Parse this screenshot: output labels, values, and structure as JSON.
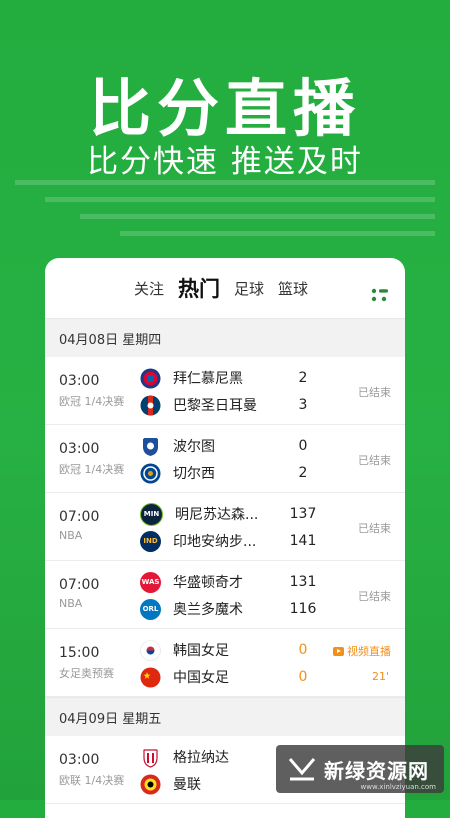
{
  "hero": {
    "title": "比分直播",
    "subtitle": "比分快速 推送及时"
  },
  "tabs": [
    {
      "label": "关注",
      "active": false
    },
    {
      "label": "热门",
      "active": true
    },
    {
      "label": "足球",
      "active": false
    },
    {
      "label": "篮球",
      "active": false
    }
  ],
  "menu_icon": "grid-menu-icon",
  "sections": [
    {
      "date": "04月08日 星期四",
      "matches": [
        {
          "time": "03:00",
          "competition": "欧冠 1/4决赛",
          "home": {
            "name": "拜仁慕尼黑",
            "logo": "bayern-logo",
            "score": "2"
          },
          "away": {
            "name": "巴黎圣日耳曼",
            "logo": "psg-logo",
            "score": "3"
          },
          "status": "已结束"
        },
        {
          "time": "03:00",
          "competition": "欧冠 1/4决赛",
          "home": {
            "name": "波尔图",
            "logo": "porto-logo",
            "score": "0"
          },
          "away": {
            "name": "切尔西",
            "logo": "chelsea-logo",
            "score": "2"
          },
          "status": "已结束"
        },
        {
          "time": "07:00",
          "competition": "NBA",
          "home": {
            "name": "明尼苏达森...",
            "logo": "MIN",
            "score": "137"
          },
          "away": {
            "name": "印地安纳步...",
            "logo": "IND",
            "score": "141"
          },
          "status": "已结束"
        },
        {
          "time": "07:00",
          "competition": "NBA",
          "home": {
            "name": "华盛顿奇才",
            "logo": "WAS",
            "score": "131"
          },
          "away": {
            "name": "奥兰多魔术",
            "logo": "ORL",
            "score": "116"
          },
          "status": "已结束"
        },
        {
          "time": "15:00",
          "competition": "女足奥预赛",
          "home": {
            "name": "韩国女足",
            "logo": "korea-flag",
            "score": "0"
          },
          "away": {
            "name": "中国女足",
            "logo": "china-flag",
            "score": "0"
          },
          "live_label": "视频直播",
          "minute": "21'"
        }
      ]
    },
    {
      "date": "04月09日 星期五",
      "matches": [
        {
          "time": "03:00",
          "competition": "欧联 1/4决赛",
          "home": {
            "name": "格拉纳达",
            "logo": "granada-logo",
            "score": ""
          },
          "away": {
            "name": "曼联",
            "logo": "manutd-logo",
            "score": ""
          }
        }
      ]
    }
  ],
  "watermark": {
    "text": "新绿资源网",
    "url": "www.xinlvziyuan.com"
  },
  "colors": {
    "brand_green": "#27b043",
    "live_orange": "#f39019",
    "status_gray": "#9a9a9a"
  }
}
